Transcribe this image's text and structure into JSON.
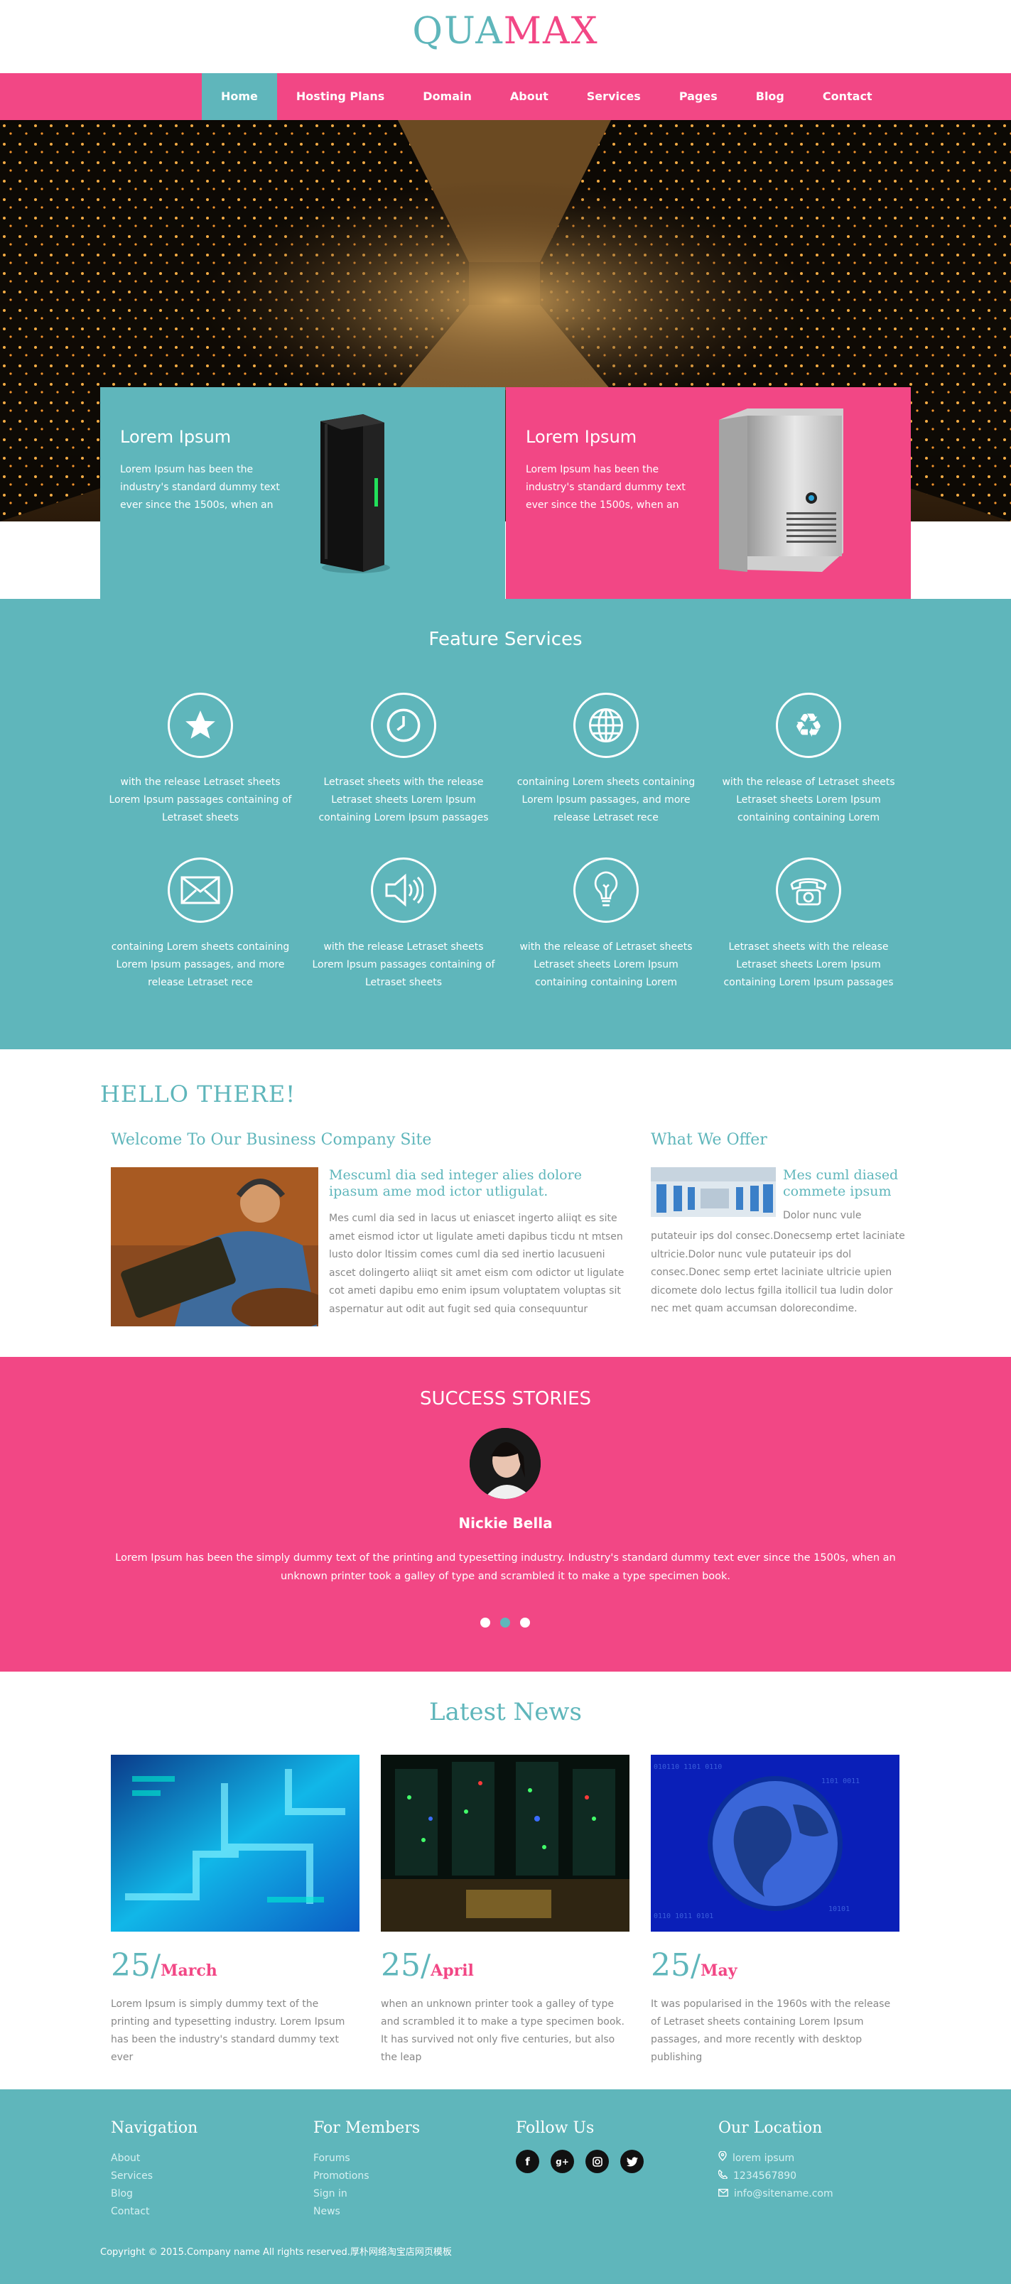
{
  "logo": {
    "part1": "QUA",
    "part2": "MAX"
  },
  "nav": {
    "items": [
      "Home",
      "Hosting Plans",
      "Domain",
      "About",
      "Services",
      "Pages",
      "Blog",
      "Contact"
    ],
    "active": "Home"
  },
  "promo": [
    {
      "title": "Lorem Ipsum",
      "text": "Lorem Ipsum has been the industry's standard dummy text ever since the 1500s, when an"
    },
    {
      "title": "Lorem Ipsum",
      "text": "Lorem Ipsum has been the industry's standard dummy text ever since the 1500s, when an"
    }
  ],
  "features": {
    "title": "Feature Services",
    "items": [
      {
        "icon": "star-icon",
        "text": "with the release Letraset sheets Lorem Ipsum passages containing of Letraset sheets"
      },
      {
        "icon": "clock-icon",
        "text": "Letraset sheets with the release Letraset sheets Lorem Ipsum containing Lorem Ipsum passages"
      },
      {
        "icon": "globe-icon",
        "text": "containing Lorem sheets containing Lorem Ipsum passages, and more release Letraset rece"
      },
      {
        "icon": "recycle-icon",
        "text": "with the release of Letraset sheets Letraset sheets Lorem Ipsum containing containing Lorem"
      },
      {
        "icon": "envelope-icon",
        "text": "containing Lorem sheets containing Lorem Ipsum passages, and more release Letraset rece"
      },
      {
        "icon": "speaker-icon",
        "text": "with the release Letraset sheets Lorem Ipsum passages containing of Letraset sheets"
      },
      {
        "icon": "lightbulb-icon",
        "text": "with the release of Letraset sheets Letraset sheets Lorem Ipsum containing containing Lorem"
      },
      {
        "icon": "phone-icon",
        "text": "Letraset sheets with the release Letraset sheets Lorem Ipsum containing Lorem Ipsum passages"
      }
    ]
  },
  "hello": {
    "title": "HELLO THERE!",
    "welcome_title": "Welcome To Our Business Company Site",
    "welcome_subtitle": "Mescuml dia sed integer alies dolore ipasum ame mod ictor utligulat.",
    "welcome_text": "Mes cuml dia sed in lacus ut eniascet ingerto aliiqt es site amet eismod ictor ut ligulate ameti dapibus ticdu nt mtsen lusto dolor ltissim comes cuml dia sed inertio lacusueni ascet dolingerto aliiqt sit amet eism com odictor ut ligulate cot ameti dapibu emo enim ipsum voluptatem voluptas sit aspernatur aut odit aut fugit sed quia consequuntur",
    "offer_title": "What We Offer",
    "offer_subtitle": "Mes cuml diased commete ipsum",
    "offer_text1": "Dolor nunc vule",
    "offer_text2": "putateuir ips dol consec.Donecsemp ertet laciniate ultricie.Dolor nunc vule putateuir ips dol consec.Donec semp ertet laciniate ultricie upien dicomete dolo lectus fgilla itollicil tua ludin dolor nec met quam accumsan dolorecondime."
  },
  "success": {
    "title": "SUCCESS STORIES",
    "name": "Nickie Bella",
    "quote": "Lorem Ipsum has been the simply dummy text of the printing and typesetting industry. Industry's standard dummy text ever since the 1500s, when an unknown printer took a galley of type and scrambled it to make a type specimen book.",
    "active_dot": 1
  },
  "news": {
    "title": "Latest News",
    "items": [
      {
        "day": "25",
        "sep": "/",
        "month": "March",
        "text": "Lorem Ipsum is simply dummy text of the printing and typesetting industry. Lorem Ipsum has been the industry's standard dummy text ever"
      },
      {
        "day": "25",
        "sep": "/",
        "month": "April",
        "text": "when an unknown printer took a galley of type and scrambled it to make a type specimen book. It has survived not only five centuries, but also the leap"
      },
      {
        "day": "25",
        "sep": "/",
        "month": "May",
        "text": "It was popularised in the 1960s with the release of Letraset sheets containing Lorem Ipsum passages, and more recently with desktop publishing"
      }
    ]
  },
  "footer": {
    "nav_title": "Navigation",
    "nav_links": [
      "About",
      "Services",
      "Blog",
      "Contact"
    ],
    "members_title": "For Members",
    "members_links": [
      "Forums",
      "Promotions",
      "Sign in",
      "News"
    ],
    "follow_title": "Follow Us",
    "social": [
      "f",
      "g+",
      "ig",
      "t"
    ],
    "location_title": "Our Location",
    "location": [
      "lorem ipsum",
      "1234567890",
      "info@sitename.com"
    ],
    "copyright": "Copyright © 2015.Company name All rights reserved.厚朴网络淘宝店网页模板"
  },
  "colors": {
    "pink": "#f24785",
    "teal": "#5fb6bb"
  }
}
